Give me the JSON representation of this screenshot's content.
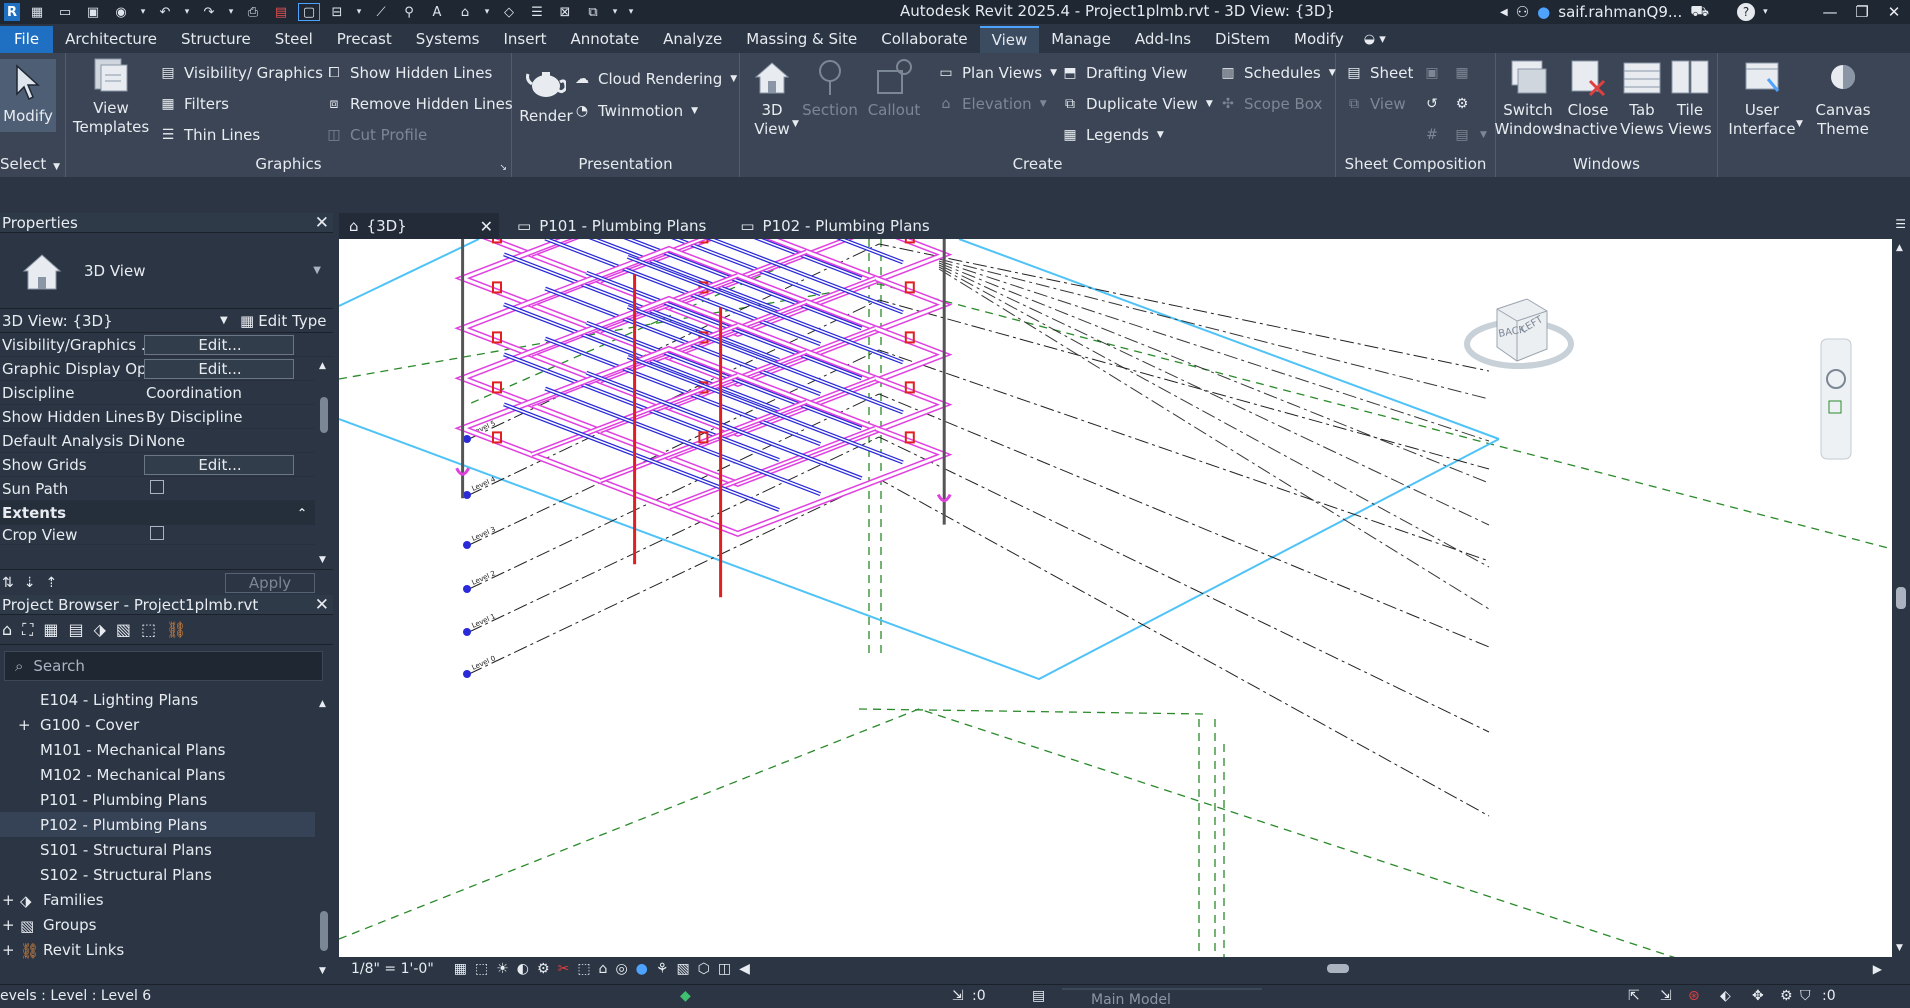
{
  "app": {
    "title": "Autodesk Revit 2025.4 - Project1plmb.rvt - 3D View: {3D}",
    "user": "saif.rahmanQ9...",
    "logo": "R"
  },
  "ribbon_tabs": [
    "File",
    "Architecture",
    "Structure",
    "Steel",
    "Precast",
    "Systems",
    "Insert",
    "Annotate",
    "Analyze",
    "Massing & Site",
    "Collaborate",
    "View",
    "Manage",
    "Add-Ins",
    "DiStem",
    "Modify"
  ],
  "active_tab": "View",
  "ribbon": {
    "select": {
      "modify": "Modify",
      "label": "Select"
    },
    "graphics": {
      "label": "Graphics",
      "view_templates_1": "View",
      "view_templates_2": "Templates",
      "visibility": "Visibility/ Graphics",
      "filters": "Filters",
      "thin_lines": "Thin  Lines",
      "show_hidden": "Show  Hidden Lines",
      "remove_hidden": "Remove  Hidden Lines",
      "cut_profile": "Cut  Profile"
    },
    "presentation": {
      "label": "Presentation",
      "render": "Render",
      "cloud_rendering": "Cloud  Rendering",
      "twinmotion": "Twinmotion"
    },
    "create": {
      "label": "Create",
      "view3d_1": "3D",
      "view3d_2": "View",
      "section": "Section",
      "callout": "Callout",
      "plan_views": "Plan  Views",
      "elevation": "Elevation",
      "drafting_view": "Drafting  View",
      "duplicate_view": "Duplicate  View",
      "legends": "Legends",
      "schedules": "Schedules",
      "scope_box": "Scope  Box"
    },
    "sheet_composition": {
      "label": "Sheet Composition",
      "sheet": "Sheet",
      "view": "View"
    },
    "windows": {
      "label": "Windows",
      "switch_1": "Switch",
      "switch_2": "Windows",
      "close_1": "Close",
      "close_2": "Inactive",
      "tab_1": "Tab",
      "tab_2": "Views",
      "tile_1": "Tile",
      "tile_2": "Views"
    },
    "ui": {
      "user_1": "User",
      "user_2": "Interface",
      "canvas_1": "Canvas",
      "canvas_2": "Theme"
    }
  },
  "properties": {
    "title": "Properties",
    "type_name": "3D View",
    "view_selector": "3D View: {3D}",
    "edit_type": "Edit Type",
    "rows": [
      {
        "k": "Visibility/Graphics ...",
        "v": "Edit..."
      },
      {
        "k": "Graphic Display Op...",
        "v": "Edit..."
      },
      {
        "k": "Discipline",
        "v": "Coordination"
      },
      {
        "k": "Show Hidden Lines",
        "v": "By Discipline"
      },
      {
        "k": "Default Analysis Dis...",
        "v": "None"
      },
      {
        "k": "Show Grids",
        "v": "Edit..."
      },
      {
        "k": "Sun Path",
        "v": ""
      }
    ],
    "section_extents": "Extents",
    "crop_view": "Crop View",
    "apply": "Apply"
  },
  "project_browser": {
    "title": "Project Browser - Project1plmb.rvt",
    "search_placeholder": "Search",
    "items": [
      {
        "label": "E104 - Lighting Plans"
      },
      {
        "label": "G100 - Cover"
      },
      {
        "label": "M101 - Mechanical Plans"
      },
      {
        "label": "M102 - Mechanical Plans"
      },
      {
        "label": "P101 - Plumbing Plans"
      },
      {
        "label": "P102 - Plumbing Plans"
      },
      {
        "label": "S101 - Structural Plans"
      },
      {
        "label": "S102 - Structural Plans"
      },
      {
        "label": "Families"
      },
      {
        "label": "Groups"
      },
      {
        "label": "Revit Links"
      }
    ]
  },
  "view_tabs": [
    "{3D}",
    "P101 - Plumbing Plans",
    "P102 - Plumbing Plans"
  ],
  "levels": [
    "Level 5",
    "Level 4",
    "Level 3",
    "Level 2",
    "Level 1",
    "Level 0"
  ],
  "viewcube": {
    "back": "BACK",
    "left": "LEFT"
  },
  "view_control": {
    "scale": "1/8\" = 1'-0\""
  },
  "status": {
    "left": "evels : Level : Level 6",
    "worksets": ":0",
    "model": "Main Model",
    "filter": ":0"
  },
  "colors": {
    "accent": "#1f6fc2",
    "pipe_magenta": "#e040e0",
    "pipe_blue": "#2a2ad8",
    "fixture_red": "#e02020",
    "grid_green": "#2a8a2a",
    "cyan": "#4fc3f7"
  }
}
